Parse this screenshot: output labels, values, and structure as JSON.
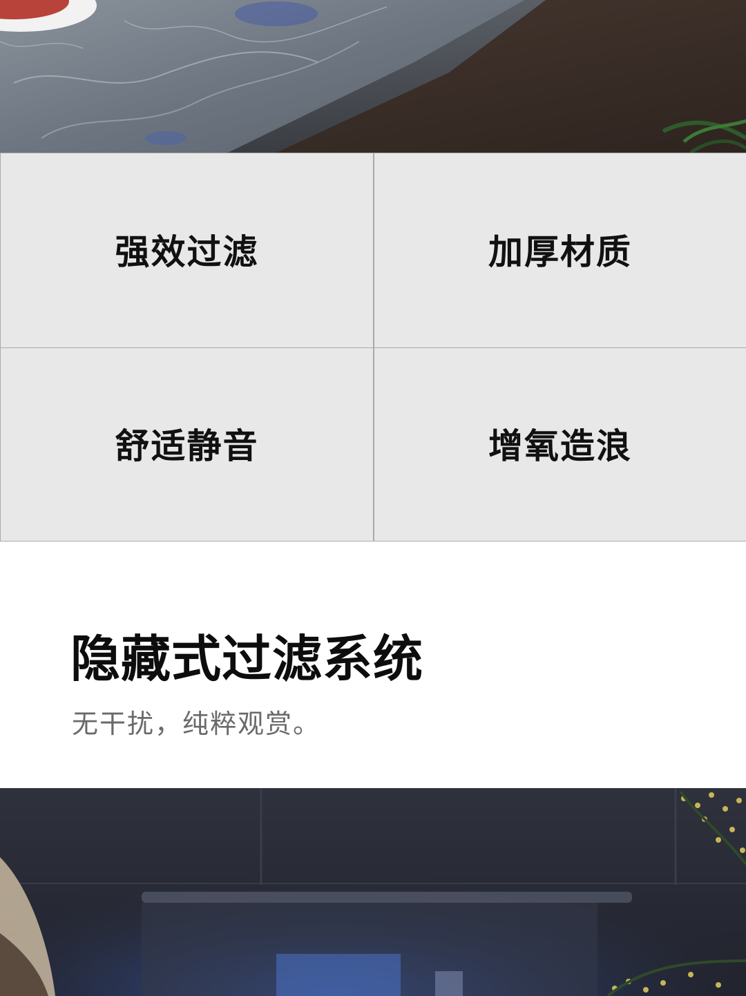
{
  "features": [
    {
      "label": "强效过滤"
    },
    {
      "label": "加厚材质"
    },
    {
      "label": "舒适静音"
    },
    {
      "label": "增氧造浪"
    }
  ],
  "section": {
    "title": "隐藏式过滤系统",
    "subtitle": "无干扰，纯粹观赏。"
  },
  "colors": {
    "grid_background": "#e8e8e8",
    "grid_border": "#a9a9a9",
    "title_text": "#0d0d0d",
    "subtitle_text": "#6a6a6a"
  }
}
